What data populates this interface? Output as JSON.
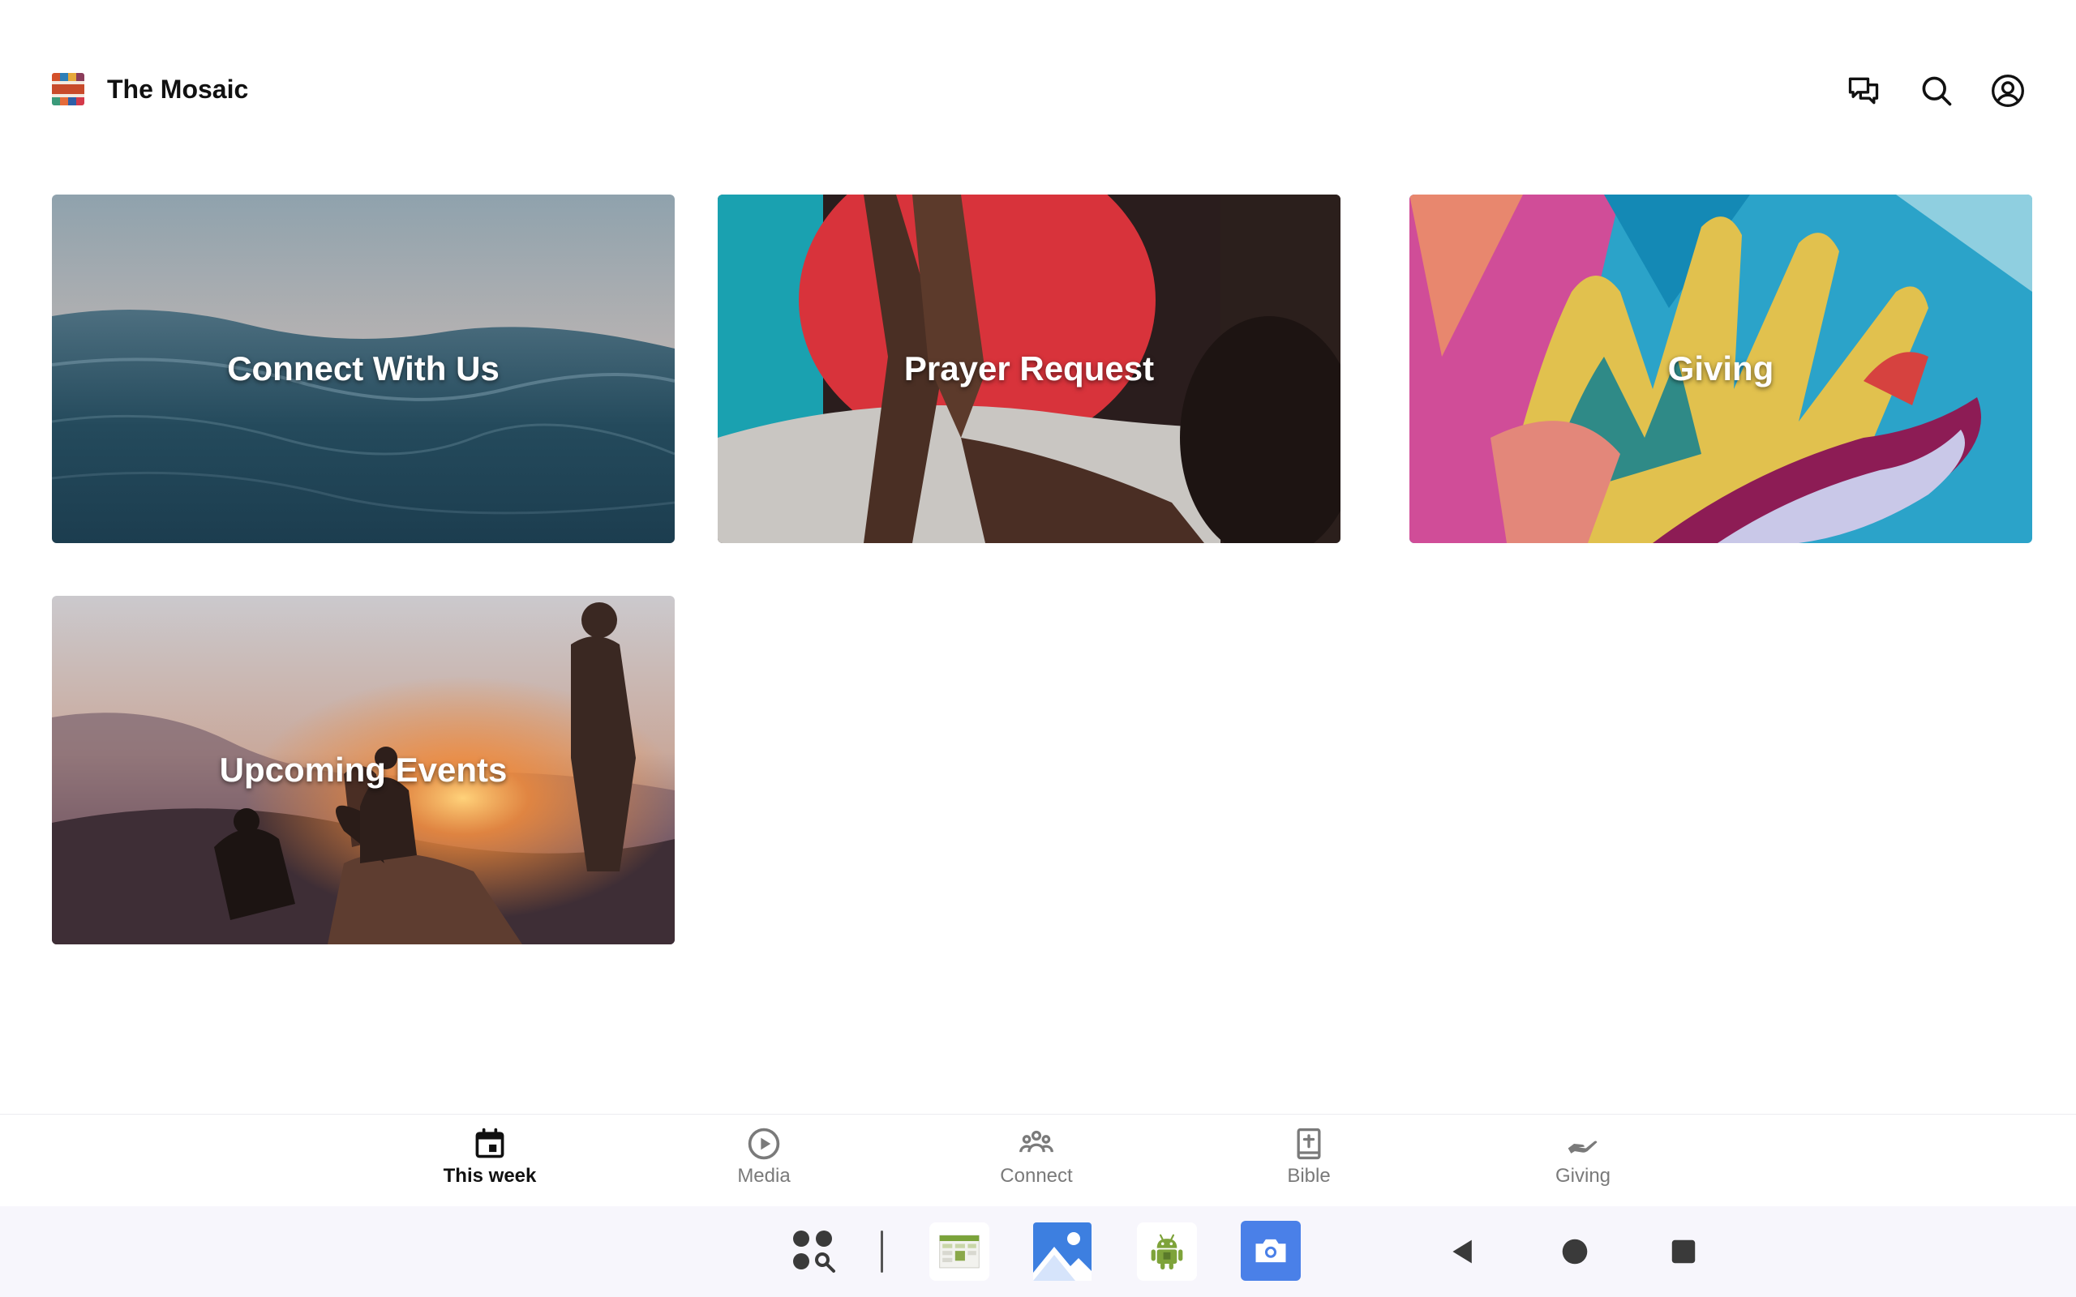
{
  "header": {
    "app_title": "The Mosaic",
    "logo_icon": "mosaic-logo-icon",
    "actions": [
      {
        "icon": "chat-icon"
      },
      {
        "icon": "search-icon"
      },
      {
        "icon": "account-icon"
      }
    ]
  },
  "cards": [
    {
      "label": "Connect With Us",
      "image": "ocean-waves"
    },
    {
      "label": "Prayer Request",
      "image": "hands-touching"
    },
    {
      "label": "Giving",
      "image": "colorful-hands-mural"
    },
    {
      "label": "Upcoming Events",
      "image": "sunset-hikers"
    }
  ],
  "tabbar": {
    "items": [
      {
        "label": "This week",
        "icon": "calendar-icon",
        "active": true
      },
      {
        "label": "Media",
        "icon": "play-circle-icon",
        "active": false
      },
      {
        "label": "Connect",
        "icon": "group-icon",
        "active": false
      },
      {
        "label": "Bible",
        "icon": "bible-icon",
        "active": false
      },
      {
        "label": "Giving",
        "icon": "giving-hand-icon",
        "active": false
      }
    ]
  },
  "system_bar": {
    "apps": [
      "app-search-icon",
      "sheets-app-icon",
      "gallery-app-icon",
      "android-app-icon",
      "camera-app-icon"
    ],
    "nav": [
      "back-icon",
      "home-icon",
      "recents-icon"
    ]
  },
  "colors": {
    "accent": "#111111",
    "tab_inactive": "#7a7a7a",
    "system_bar_bg": "#f7f6fc",
    "camera_blue": "#4a80e8"
  }
}
